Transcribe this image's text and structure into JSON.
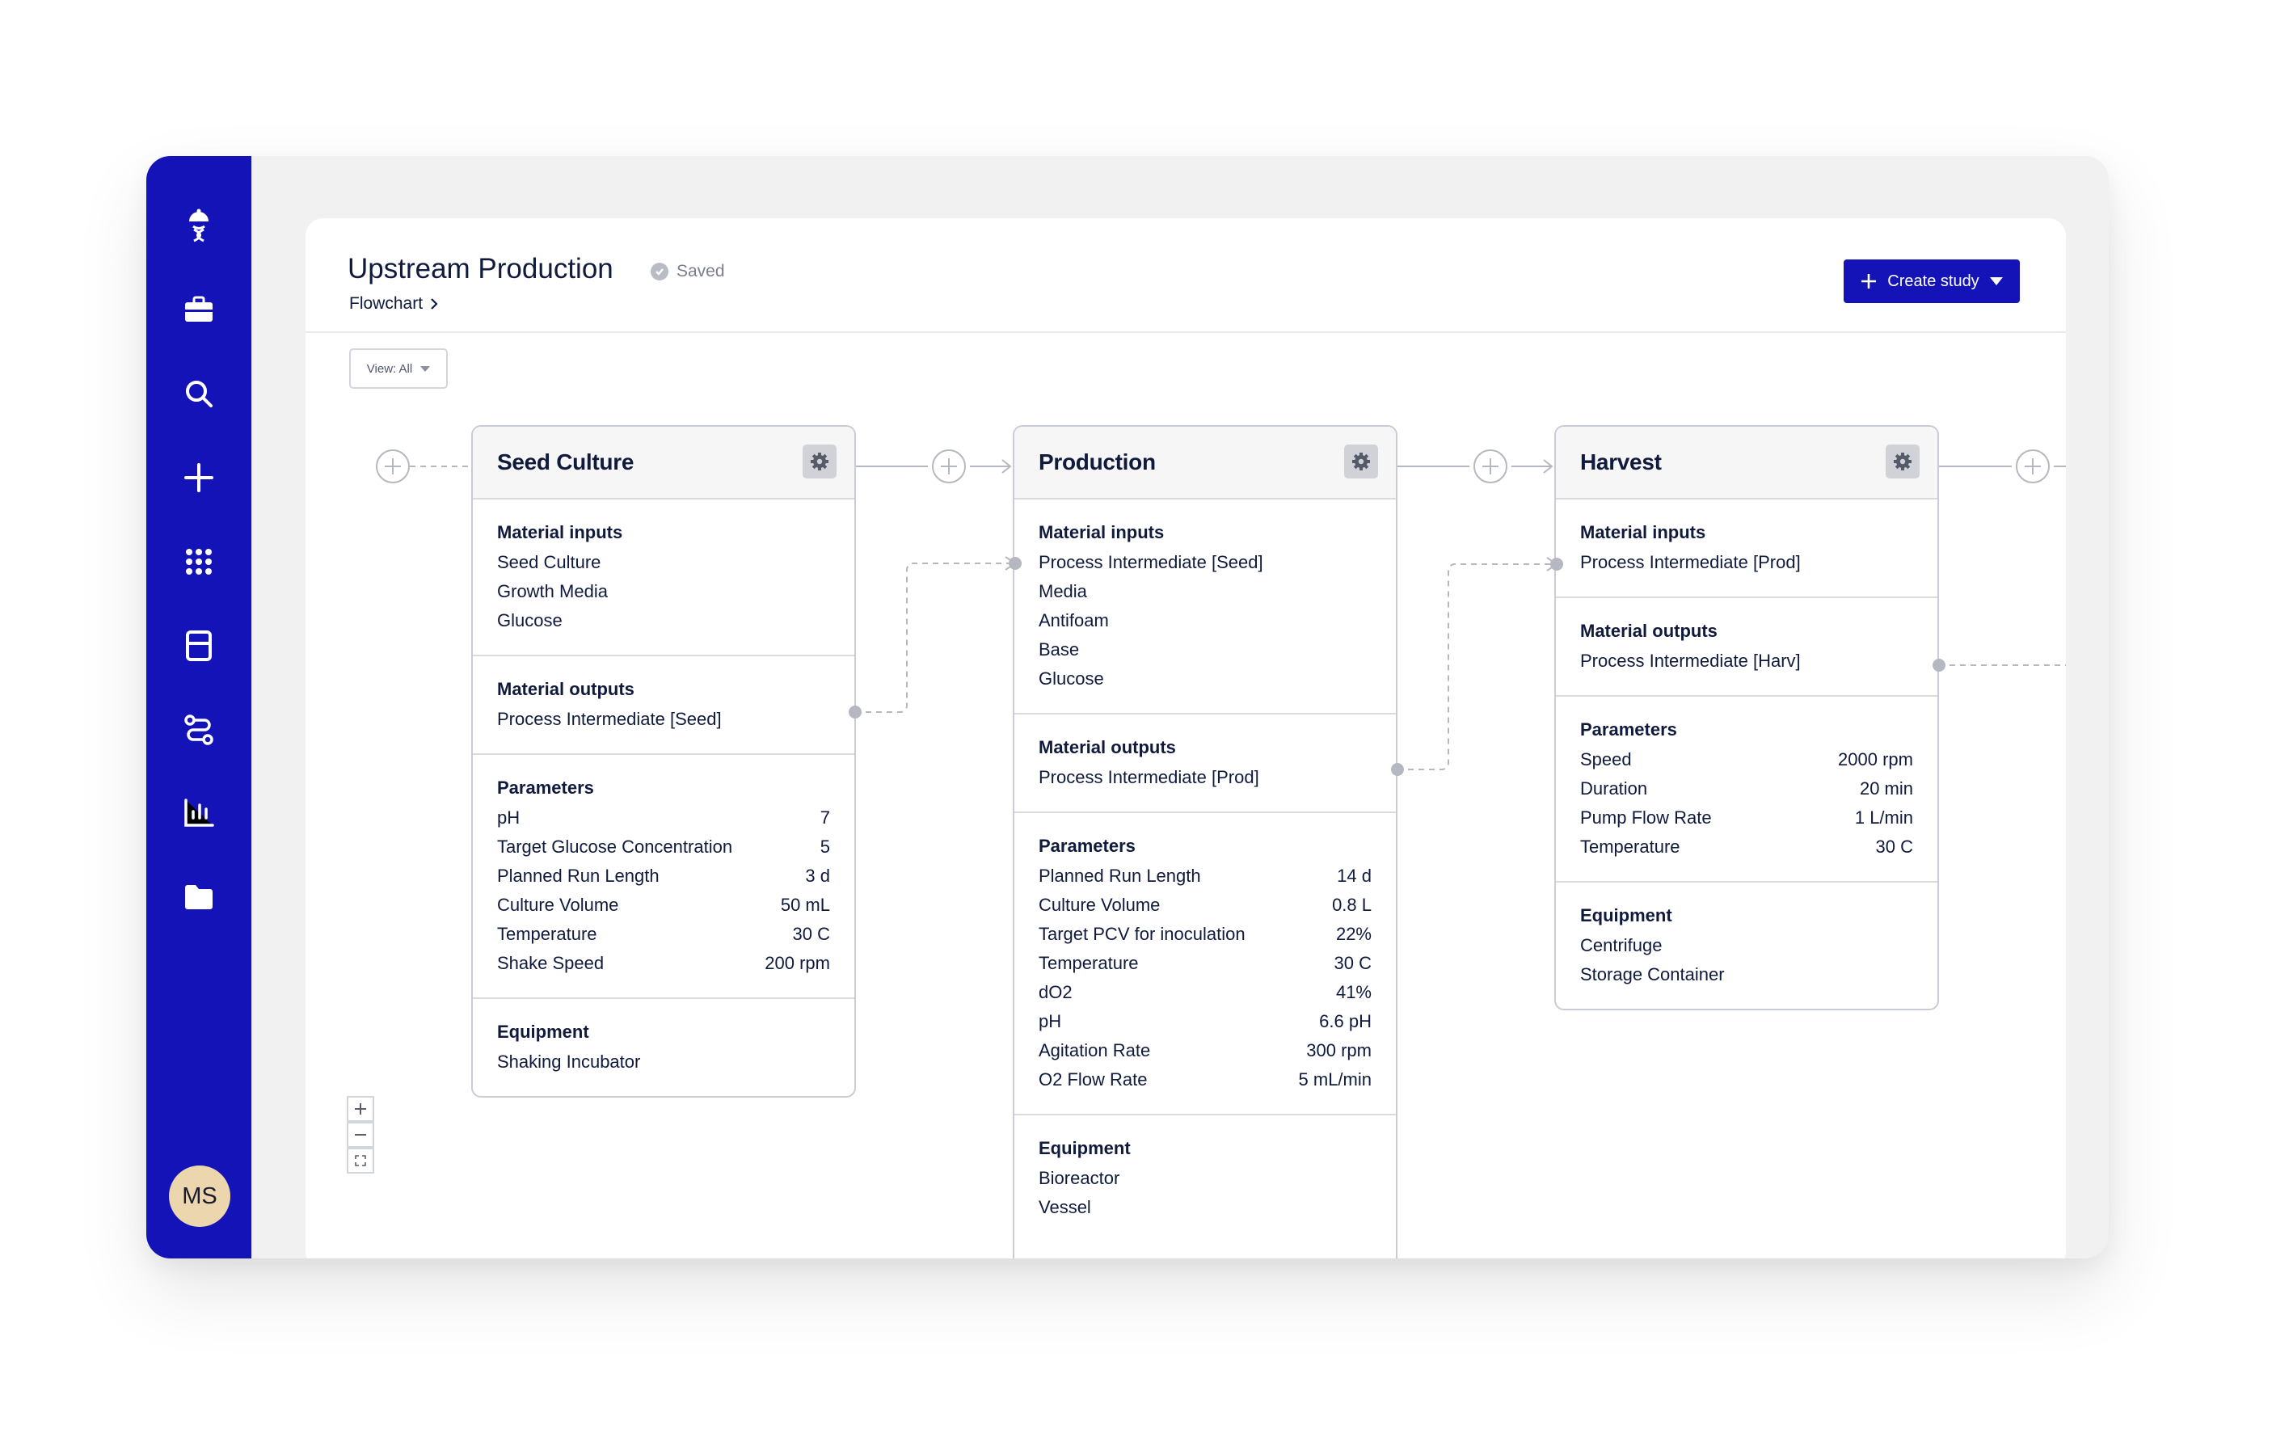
{
  "app": {
    "page_title": "Upstream Production",
    "save_status": "Saved",
    "breadcrumb": "Flowchart",
    "create_button": "Create study",
    "view_filter": "View: All"
  },
  "sidebar": {
    "items": [
      "logo-icon",
      "briefcase-icon",
      "search-icon",
      "plus-icon",
      "apps-grid-icon",
      "layout-icon",
      "workflow-icon",
      "bar-chart-icon",
      "folder-icon"
    ],
    "avatar_initials": "MS"
  },
  "colors": {
    "accent": "#1313b8",
    "avatar": "#ecd6ae"
  },
  "steps": [
    {
      "title": "Seed Culture",
      "material_inputs_label": "Material inputs",
      "material_inputs": [
        "Seed Culture",
        "Growth Media",
        "Glucose"
      ],
      "material_outputs_label": "Material outputs",
      "material_outputs": [
        "Process Intermediate [Seed]"
      ],
      "parameters_label": "Parameters",
      "parameters": [
        {
          "name": "pH",
          "value": "7"
        },
        {
          "name": "Target Glucose Concentration",
          "value": "5"
        },
        {
          "name": "Planned Run Length",
          "value": "3 d"
        },
        {
          "name": "Culture Volume",
          "value": "50 mL"
        },
        {
          "name": "Temperature",
          "value": "30 C"
        },
        {
          "name": "Shake Speed",
          "value": "200 rpm"
        }
      ],
      "equipment_label": "Equipment",
      "equipment": [
        "Shaking Incubator"
      ]
    },
    {
      "title": "Production",
      "material_inputs_label": "Material inputs",
      "material_inputs": [
        "Process Intermediate [Seed]",
        "Media",
        "Antifoam",
        "Base",
        "Glucose"
      ],
      "material_outputs_label": "Material outputs",
      "material_outputs": [
        "Process Intermediate [Prod]"
      ],
      "parameters_label": "Parameters",
      "parameters": [
        {
          "name": "Planned Run Length",
          "value": "14 d"
        },
        {
          "name": "Culture Volume",
          "value": "0.8 L"
        },
        {
          "name": "Target PCV for inoculation",
          "value": "22%"
        },
        {
          "name": "Temperature",
          "value": "30 C"
        },
        {
          "name": "dO2",
          "value": "41%"
        },
        {
          "name": "pH",
          "value": "6.6 pH"
        },
        {
          "name": "Agitation Rate",
          "value": "300 rpm"
        },
        {
          "name": "O2 Flow Rate",
          "value": "5 mL/min"
        }
      ],
      "equipment_label": "Equipment",
      "equipment": [
        "Bioreactor",
        "Vessel"
      ]
    },
    {
      "title": "Harvest",
      "material_inputs_label": "Material inputs",
      "material_inputs": [
        "Process Intermediate [Prod]"
      ],
      "material_outputs_label": "Material outputs",
      "material_outputs": [
        "Process Intermediate [Harv]"
      ],
      "parameters_label": "Parameters",
      "parameters": [
        {
          "name": "Speed",
          "value": "2000 rpm"
        },
        {
          "name": "Duration",
          "value": "20 min"
        },
        {
          "name": "Pump Flow Rate",
          "value": "1 L/min"
        },
        {
          "name": "Temperature",
          "value": "30 C"
        }
      ],
      "equipment_label": "Equipment",
      "equipment": [
        "Centrifuge",
        "Storage Container"
      ]
    }
  ]
}
